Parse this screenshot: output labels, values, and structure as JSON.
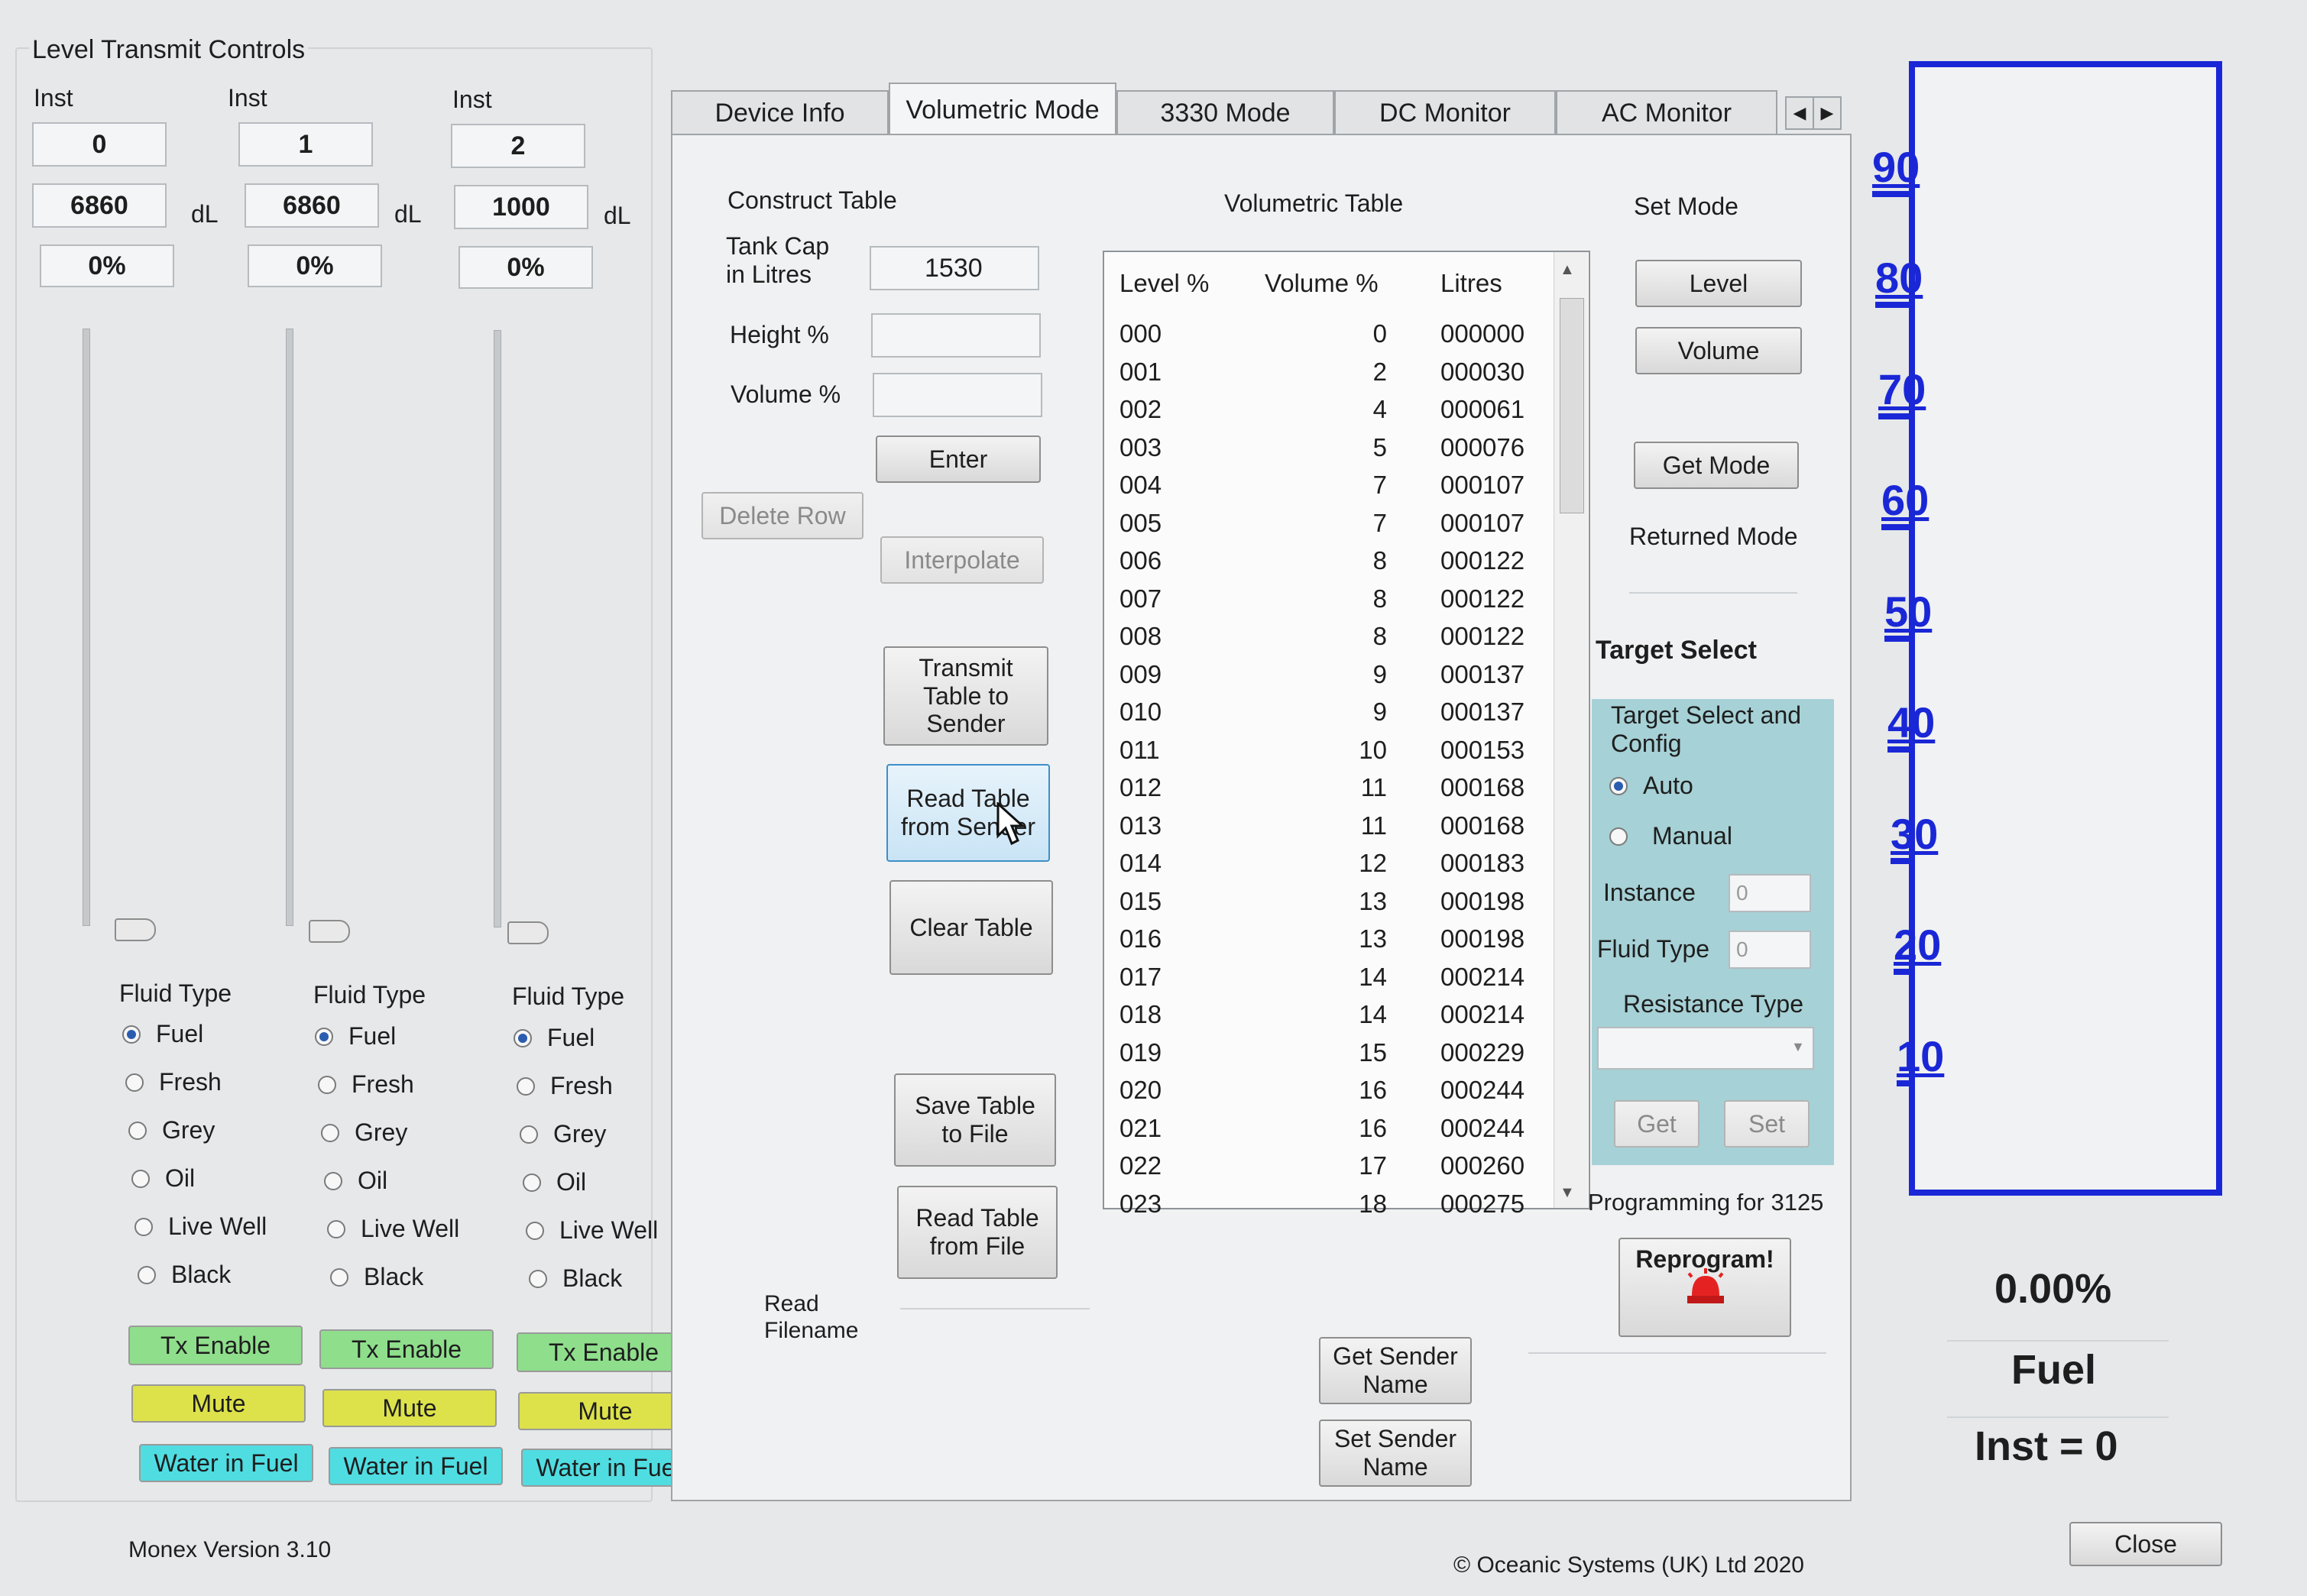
{
  "left": {
    "title": "Level Transmit Controls",
    "version": "Monex Version 3.10",
    "instances": [
      {
        "inst_label": "Inst",
        "inst": "0",
        "value": "6860",
        "unit": "dL",
        "percent": "0%",
        "fluid_type_label": "Fluid Type",
        "selected": "Fuel",
        "tx": "Tx Enable",
        "mute": "Mute",
        "wif": "Water in Fuel"
      },
      {
        "inst_label": "Inst",
        "inst": "1",
        "value": "6860",
        "unit": "dL",
        "percent": "0%",
        "fluid_type_label": "Fluid Type",
        "selected": "Fuel",
        "tx": "Tx Enable",
        "mute": "Mute",
        "wif": "Water in Fuel"
      },
      {
        "inst_label": "Inst",
        "inst": "2",
        "value": "1000",
        "unit": "dL",
        "percent": "0%",
        "fluid_type_label": "Fluid Type",
        "selected": "Fuel",
        "tx": "Tx Enable",
        "mute": "Mute",
        "wif": "Water in Fuel"
      }
    ],
    "fluid_options": [
      "Fuel",
      "Fresh",
      "Grey",
      "Oil",
      "Live Well",
      "Black"
    ]
  },
  "tabs": [
    "Device Info",
    "Volumetric Mode",
    "3330 Mode",
    "DC Monitor",
    "AC Monitor"
  ],
  "active_tab": "Volumetric Mode",
  "construct": {
    "title": "Construct Table",
    "tank_cap_label": "Tank Cap\nin Litres",
    "tank_cap_value": "1530",
    "height_label": "Height %",
    "volume_label": "Volume %",
    "enter": "Enter",
    "delete_row": "Delete Row",
    "interpolate": "Interpolate",
    "transmit": "Transmit\nTable to\nSender",
    "read_sender": "Read Table\nfrom Sender",
    "clear": "Clear Table",
    "save_file": "Save Table\nto File",
    "read_file": "Read Table\nfrom File",
    "read_filename": "Read\nFilename"
  },
  "vol_table": {
    "title": "Volumetric Table",
    "headers": [
      "Level %",
      "Volume %",
      "Litres"
    ],
    "rows": [
      [
        "000",
        "0",
        "000000"
      ],
      [
        "001",
        "2",
        "000030"
      ],
      [
        "002",
        "4",
        "000061"
      ],
      [
        "003",
        "5",
        "000076"
      ],
      [
        "004",
        "7",
        "000107"
      ],
      [
        "005",
        "7",
        "000107"
      ],
      [
        "006",
        "8",
        "000122"
      ],
      [
        "007",
        "8",
        "000122"
      ],
      [
        "008",
        "8",
        "000122"
      ],
      [
        "009",
        "9",
        "000137"
      ],
      [
        "010",
        "9",
        "000137"
      ],
      [
        "011",
        "10",
        "000153"
      ],
      [
        "012",
        "11",
        "000168"
      ],
      [
        "013",
        "11",
        "000168"
      ],
      [
        "014",
        "12",
        "000183"
      ],
      [
        "015",
        "13",
        "000198"
      ],
      [
        "016",
        "13",
        "000198"
      ],
      [
        "017",
        "14",
        "000214"
      ],
      [
        "018",
        "14",
        "000214"
      ],
      [
        "019",
        "15",
        "000229"
      ],
      [
        "020",
        "16",
        "000244"
      ],
      [
        "021",
        "16",
        "000244"
      ],
      [
        "022",
        "17",
        "000260"
      ],
      [
        "023",
        "18",
        "000275"
      ]
    ],
    "get_sender_name": "Get Sender\nName",
    "set_sender_name": "Set Sender\nName"
  },
  "set_mode": {
    "title": "Set Mode",
    "level": "Level",
    "volume": "Volume",
    "get_mode": "Get Mode",
    "returned_mode": "Returned Mode"
  },
  "target": {
    "title": "Target Select",
    "config_title": "Target Select and\nConfig",
    "auto": "Auto",
    "manual": "Manual",
    "selected": "Auto",
    "instance_label": "Instance",
    "instance_value": "0",
    "fluid_type_label": "Fluid Type",
    "fluid_type_value": "0",
    "resistance_label": "Resistance Type",
    "get": "Get",
    "set": "Set",
    "programming": "Programming for 3125",
    "reprogram": "Reprogram!"
  },
  "gauge": {
    "ticks": [
      "90",
      "80",
      "70",
      "60",
      "50",
      "40",
      "30",
      "20",
      "10"
    ],
    "level_fraction": 0.0,
    "percent": "0.00%",
    "fluid": "Fuel",
    "inst": "Inst = 0",
    "color": "#1a27d6"
  },
  "footer": {
    "copyright": "© Oceanic Systems (UK) Ltd 2020",
    "close": "Close"
  }
}
